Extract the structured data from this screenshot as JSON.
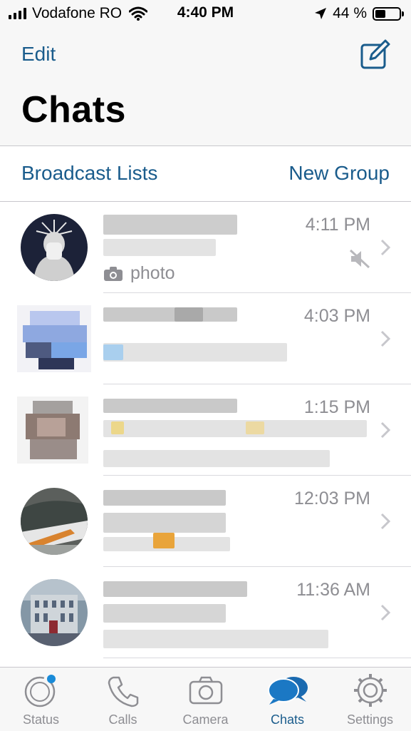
{
  "status_bar": {
    "carrier": "Vodafone RO",
    "time": "4:40 PM",
    "battery": "44 %",
    "battery_level": 0.44,
    "icons": [
      "signal-icon",
      "wifi-icon",
      "location-icon",
      "battery-icon"
    ]
  },
  "header": {
    "edit_label": "Edit",
    "title": "Chats",
    "compose_icon": "compose-icon"
  },
  "actions": {
    "broadcast_label": "Broadcast Lists",
    "new_group_label": "New Group"
  },
  "chats": [
    {
      "time": "4:11 PM",
      "preview": "photo",
      "muted": true,
      "avatar": "statue-avatar"
    },
    {
      "time": "4:03 PM",
      "avatar": "blurred-avatar"
    },
    {
      "time": "1:15 PM",
      "avatar": "blurred-avatar"
    },
    {
      "time": "12:03 PM",
      "avatar": "car-avatar"
    },
    {
      "time": "11:36 AM",
      "avatar": "building-avatar"
    }
  ],
  "tabs": [
    {
      "label": "Status",
      "icon": "status-icon",
      "active": false
    },
    {
      "label": "Calls",
      "icon": "phone-icon",
      "active": false
    },
    {
      "label": "Camera",
      "icon": "camera-icon",
      "active": false
    },
    {
      "label": "Chats",
      "icon": "chat-bubbles-icon",
      "active": true
    },
    {
      "label": "Settings",
      "icon": "gear-icon",
      "active": false
    }
  ],
  "colors": {
    "accent": "#1a5c8c",
    "secondary_text": "#8e8e93",
    "bar_background": "#f7f7f7",
    "separator": "#c8c7cc"
  }
}
